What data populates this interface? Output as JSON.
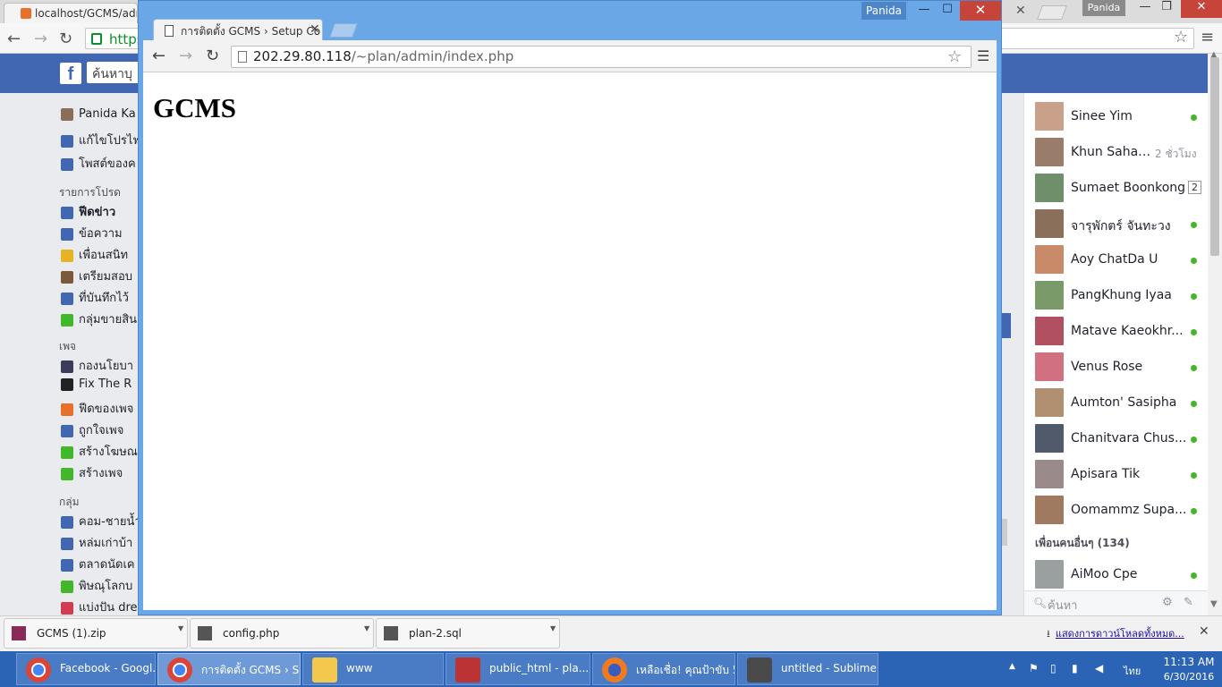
{
  "background_browser": {
    "tab_title": "localhost/GCMS/adm",
    "url_prefix": "https",
    "user": "Panida"
  },
  "facebook": {
    "search_placeholder": "ค้นหาบุ",
    "left_nav": {
      "profile": [
        {
          "label": "Panida Ka",
          "icon": "avatar-icon"
        },
        {
          "label": "แก้ไขโปรไฟ",
          "icon": "pencil-icon"
        },
        {
          "label": "โพสต์ของค",
          "icon": "person-icon"
        }
      ],
      "favorites_heading": "รายการโปรด",
      "favorites": [
        {
          "label": "ฟีดข่าว",
          "icon": "news-icon"
        },
        {
          "label": "ข้อความ",
          "icon": "message-icon"
        },
        {
          "label": "เพื่อนสนิท",
          "icon": "star-icon"
        },
        {
          "label": "เตรียมสอบ",
          "icon": "book-icon"
        },
        {
          "label": "ที่บันทึกไว้",
          "icon": "bookmark-icon"
        },
        {
          "label": "กลุ่มขายสิน",
          "icon": "tag-icon"
        }
      ],
      "pages_heading": "เพจ",
      "pages": [
        {
          "label": "กองนโยบา",
          "icon": "page-avatar-icon"
        },
        {
          "label": "Fix The R",
          "icon": "pin-icon"
        },
        {
          "label": "ฟีดของเพจ",
          "icon": "flag-icon"
        },
        {
          "label": "ถูกใจเพจ",
          "icon": "like-icon"
        },
        {
          "label": "สร้างโฆษณ",
          "icon": "plus-icon"
        },
        {
          "label": "สร้างเพจ",
          "icon": "plus-icon"
        }
      ],
      "groups_heading": "กลุ่ม",
      "groups": [
        {
          "label": "คอม-ชายน้ำ",
          "icon": "flask-icon"
        },
        {
          "label": "หล่มเก่าบ้า",
          "icon": "group-icon"
        },
        {
          "label": "ตลาดนัดเค",
          "icon": "link-icon"
        },
        {
          "label": "พิษณุโลกบ",
          "icon": "house-icon"
        },
        {
          "label": "แบ่งปัน dre",
          "icon": "heart-icon"
        }
      ]
    },
    "chat": {
      "contacts": [
        {
          "name": "Sinee Yim",
          "status": "online"
        },
        {
          "name": "Khun Sahap...",
          "status": "2 ชั่วโมง"
        },
        {
          "name": "Sumaet Boonkong",
          "status": "2"
        },
        {
          "name": "จารุพักตร์ จันทะวง",
          "status": "online"
        },
        {
          "name": "Aoy ChatDa U",
          "status": "online"
        },
        {
          "name": "PangKhung Iyaa",
          "status": "online"
        },
        {
          "name": "Matave Kaeokhr...",
          "status": "online"
        },
        {
          "name": "Venus Rose",
          "status": "online"
        },
        {
          "name": "Aumton' Sasipha",
          "status": "online"
        },
        {
          "name": "Chanitvara Chus...",
          "status": "online"
        },
        {
          "name": "Apisara Tik",
          "status": "online"
        },
        {
          "name": "Oomammz Supa...",
          "status": "online"
        }
      ],
      "more_friends": "เพื่อนคนอื่นๆ (134)",
      "extra_contact": {
        "name": "AiMoo Cpe",
        "status": "online"
      },
      "search_placeholder": "ค้นหา"
    }
  },
  "popup": {
    "tab_title": "การติดตั้ง GCMS › Setup Co",
    "user": "Panida",
    "url_host": "202.29.80.118",
    "url_path": "/~plan/admin/index.php",
    "heading": "GCMS"
  },
  "downloads": {
    "items": [
      {
        "name": "GCMS (1).zip",
        "icon": "archive-icon"
      },
      {
        "name": "config.php",
        "icon": "php-file-icon"
      },
      {
        "name": "plan-2.sql",
        "icon": "sql-file-icon"
      }
    ],
    "show_all": "แสดงการดาวน์โหลดทั้งหมด..."
  },
  "taskbar": {
    "buttons": [
      {
        "label": "Facebook - Googl...",
        "icon": "chrome-icon"
      },
      {
        "label": "การติดตั้ง GCMS › S...",
        "icon": "chrome-icon"
      },
      {
        "label": "www",
        "icon": "folder-icon"
      },
      {
        "label": "public_html - pla...",
        "icon": "filezilla-icon"
      },
      {
        "label": "เหลือเชื่อ! คุณป้าขับ 5...",
        "icon": "firefox-icon"
      },
      {
        "label": "untitled - Sublime...",
        "icon": "sublime-icon"
      }
    ],
    "language": "ไทย",
    "time": "11:13 AM",
    "date": "6/30/2016"
  },
  "colors": {
    "fb_blue": "#4267b2",
    "popup_frame": "#6aa7e6",
    "taskbar": "#2b63b5",
    "online": "#42b72a",
    "close_red": "#c7443a"
  }
}
